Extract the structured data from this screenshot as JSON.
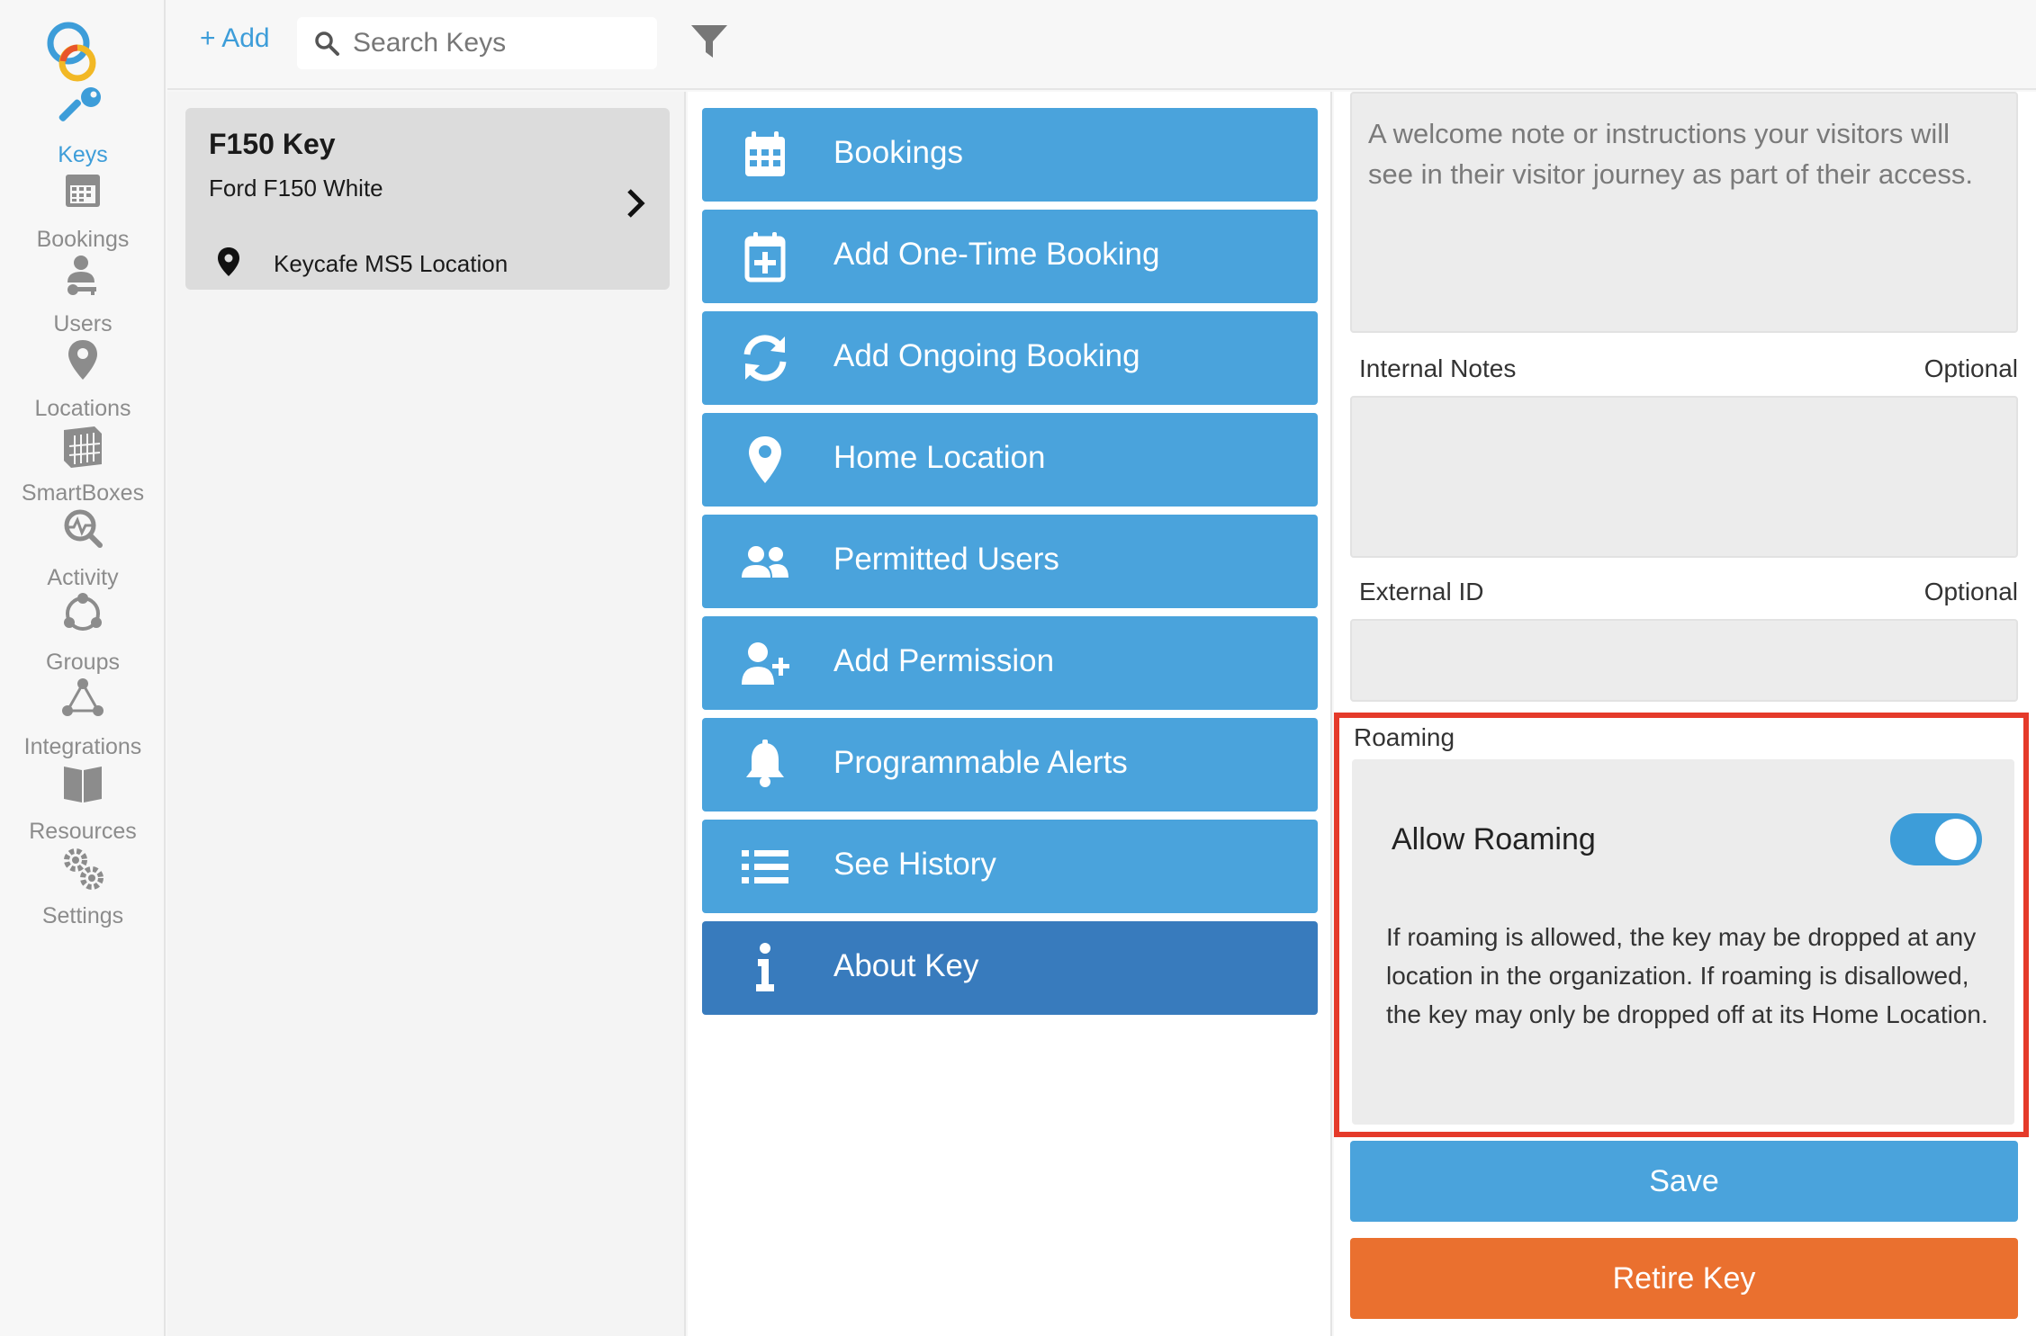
{
  "colors": {
    "accent": "#3d9dd9",
    "action_button": "#4aa3dc",
    "action_active": "#387bbd",
    "retire": "#ea702f",
    "highlight_border": "#e53a2a"
  },
  "nav": {
    "items": [
      {
        "label": "Keys",
        "icon": "key-icon",
        "active": true
      },
      {
        "label": "Bookings",
        "icon": "calendar-icon"
      },
      {
        "label": "Users",
        "icon": "user-key-icon"
      },
      {
        "label": "Locations",
        "icon": "location-pin-icon"
      },
      {
        "label": "SmartBoxes",
        "icon": "smartbox-icon"
      },
      {
        "label": "Activity",
        "icon": "activity-icon"
      },
      {
        "label": "Groups",
        "icon": "groups-icon"
      },
      {
        "label": "Integrations",
        "icon": "integrations-icon"
      },
      {
        "label": "Resources",
        "icon": "book-icon"
      },
      {
        "label": "Settings",
        "icon": "gears-icon"
      }
    ]
  },
  "topbar": {
    "add_label": "+ Add",
    "search_placeholder": "Search Keys"
  },
  "key_card": {
    "title": "F150 Key",
    "subtitle": "Ford F150 White",
    "location": "Keycafe MS5 Location"
  },
  "actions": [
    {
      "label": "Bookings",
      "icon": "calendar-icon"
    },
    {
      "label": "Add One-Time Booking",
      "icon": "calendar-plus-icon"
    },
    {
      "label": "Add Ongoing Booking",
      "icon": "sync-icon"
    },
    {
      "label": "Home Location",
      "icon": "location-pin-icon"
    },
    {
      "label": "Permitted Users",
      "icon": "users-icon"
    },
    {
      "label": "Add Permission",
      "icon": "user-plus-icon"
    },
    {
      "label": "Programmable Alerts",
      "icon": "bell-icon"
    },
    {
      "label": "See History",
      "icon": "list-icon"
    },
    {
      "label": "About Key",
      "icon": "info-icon",
      "active": true
    }
  ],
  "form": {
    "welcome_placeholder": "A welcome note or instructions your visitors will see in their visitor journey as part of their access.",
    "internal_notes_label": "Internal Notes",
    "external_id_label": "External ID",
    "optional_label": "Optional",
    "roaming": {
      "section_label": "Roaming",
      "toggle_label": "Allow Roaming",
      "enabled": true,
      "description": "If roaming is allowed, the key may be dropped at any location in the organization. If roaming is disallowed, the key may only be dropped off at its Home Location."
    },
    "save_label": "Save",
    "retire_label": "Retire Key"
  }
}
